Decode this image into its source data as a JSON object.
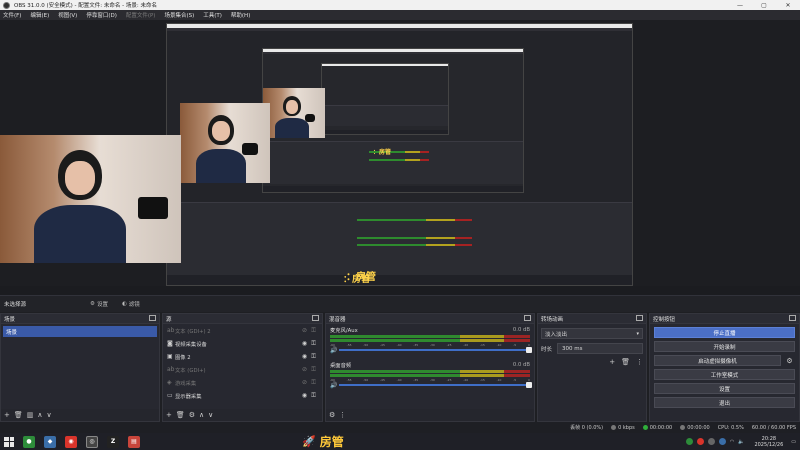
{
  "window": {
    "title": "OBS 31.0.0 (安全模式) - 配置文件: 未命名 - 场景: 未命名",
    "minimize": "—",
    "maximize": "▢",
    "close": "✕"
  },
  "menu": {
    "items": [
      {
        "label": "文件(F)",
        "enabled": true
      },
      {
        "label": "编辑(E)",
        "enabled": true
      },
      {
        "label": "视图(V)",
        "enabled": true
      },
      {
        "label": "停靠窗口(D)",
        "enabled": true
      },
      {
        "label": "配置文件(P)",
        "enabled": false
      },
      {
        "label": "场景集合(S)",
        "enabled": true
      },
      {
        "label": "工具(T)",
        "enabled": true
      },
      {
        "label": "帮助(H)",
        "enabled": true
      }
    ]
  },
  "preview": {
    "stamp_text": "房管",
    "stamp_text_colon": "：房管"
  },
  "scene_bar": {
    "current": "未选择源",
    "properties": "设置",
    "filters": "滤镜"
  },
  "scenes": {
    "title": "场景",
    "items": [
      "场景"
    ]
  },
  "sources": {
    "title": "源",
    "items": [
      {
        "icon": "text-icon",
        "glyph": "ab",
        "name": "文本 (GDI+) 2",
        "visible": false,
        "dim": true
      },
      {
        "icon": "camera-icon",
        "glyph": "◙",
        "name": "视频采集设备",
        "visible": true,
        "dim": false
      },
      {
        "icon": "image-icon",
        "glyph": "▣",
        "name": "图像 2",
        "visible": true,
        "dim": false
      },
      {
        "icon": "text-icon",
        "glyph": "ab",
        "name": "文本 (GDI+)",
        "visible": false,
        "dim": true
      },
      {
        "icon": "game-capture-icon",
        "glyph": "◈",
        "name": "游戏采集",
        "visible": false,
        "dim": true
      },
      {
        "icon": "display-capture-icon",
        "glyph": "▭",
        "name": "显示器采集",
        "visible": true,
        "dim": false
      }
    ]
  },
  "mixer": {
    "title": "混音器",
    "channels": [
      {
        "name": "麦克风/Aux",
        "db": "0.0 dB",
        "volume": 1.0
      },
      {
        "name": "桌面音频",
        "db": "0.0 dB",
        "volume": 1.0
      }
    ],
    "scale": [
      "-60",
      "-55",
      "-50",
      "-45",
      "-40",
      "-35",
      "-30",
      "-25",
      "-20",
      "-15",
      "-10",
      "-5",
      "0"
    ]
  },
  "transitions": {
    "title": "转场动画",
    "selected": "淡入淡出",
    "duration_label": "时长",
    "duration_value": "300 ms"
  },
  "controls": {
    "title": "控制按钮",
    "stop_stream": "停止直播",
    "start_record": "开始录制",
    "virtual_cam": "启动虚拟摄像机",
    "studio_mode": "工作室模式",
    "settings": "设置",
    "exit": "退出"
  },
  "status": {
    "dropped": "丢帧 0 (0.0%)",
    "bitrate": "0 kbps",
    "stream_time": "00:00:00",
    "record_time": "00:00:00",
    "cpu": "CPU: 0.5%",
    "fps": "60.00 / 60.00 FPS",
    "live_color": "#2fae3a",
    "rec_color": "#777777"
  },
  "taskbar": {
    "banner": "房管",
    "time": "20:28",
    "date": "2025/12/26",
    "lang": "中"
  },
  "colors": {
    "accent": "#4b6fc6",
    "panel": "#272830",
    "banner": "#ffc93a"
  }
}
